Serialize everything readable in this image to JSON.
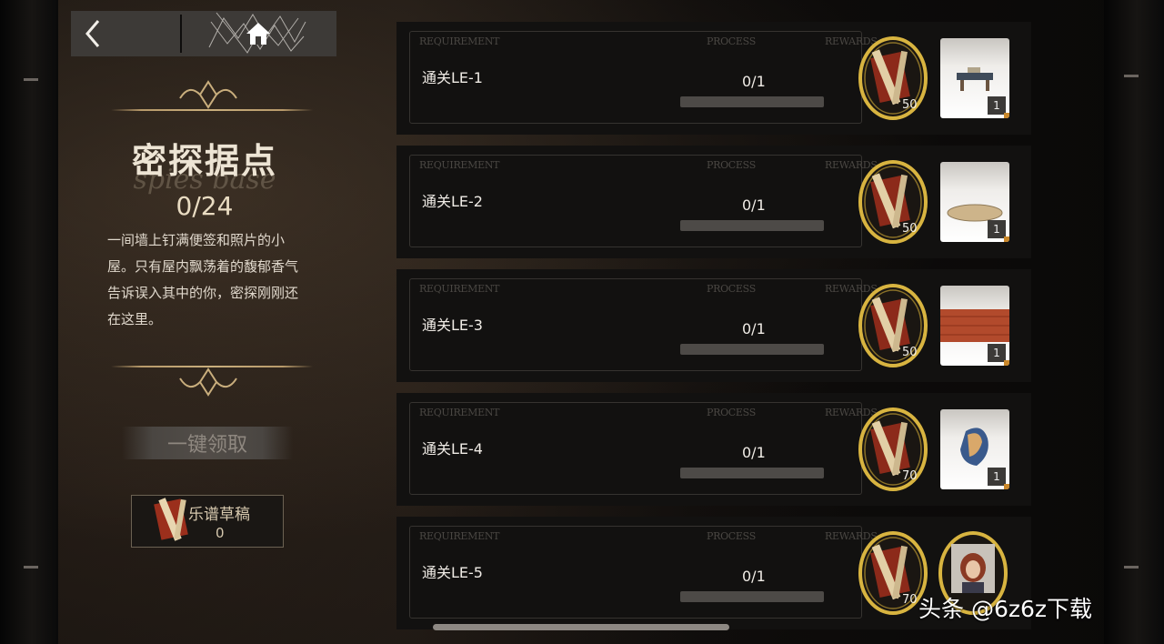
{
  "nav": {
    "back_icon": "chevron-left-icon",
    "home_icon": "home-icon"
  },
  "base": {
    "title": "密探据点",
    "subtitle": "spies base",
    "progress": "0/24",
    "description": "一间墙上钉满便签和照片的小屋。只有屋内飘荡着的馥郁香气告诉误入其中的你，密探刚刚还在这里。",
    "claim_all_label": "一键领取",
    "currency": {
      "label": "乐谱草稿",
      "count": "0"
    }
  },
  "headers": {
    "requirement": "REQUIREMENT",
    "process": "PROCESS",
    "rewards": "REWARDS"
  },
  "tasks": [
    {
      "name": "通关LE-1",
      "progress": "0/1",
      "progress_fraction": 0,
      "coin_amount": "50",
      "item_qty": "1",
      "item_icon": "table-icon"
    },
    {
      "name": "通关LE-2",
      "progress": "0/1",
      "progress_fraction": 0,
      "coin_amount": "50",
      "item_qty": "1",
      "item_icon": "rug-icon"
    },
    {
      "name": "通关LE-3",
      "progress": "0/1",
      "progress_fraction": 0,
      "coin_amount": "50",
      "item_qty": "1",
      "item_icon": "wallpaper-icon"
    },
    {
      "name": "通关LE-4",
      "progress": "0/1",
      "progress_fraction": 0,
      "coin_amount": "70",
      "item_qty": "1",
      "item_icon": "wall-emblem-icon"
    },
    {
      "name": "通关LE-5",
      "progress": "0/1",
      "progress_fraction": 0,
      "coin_amount": "70",
      "item_qty": "",
      "item_icon": "character-portrait-icon"
    }
  ],
  "watermark": "头条 @6z6z下载",
  "colors": {
    "gold_ring": "#d8b440",
    "coin_red": "#8c2a1a",
    "frame_gold": "#c9ae7d"
  }
}
